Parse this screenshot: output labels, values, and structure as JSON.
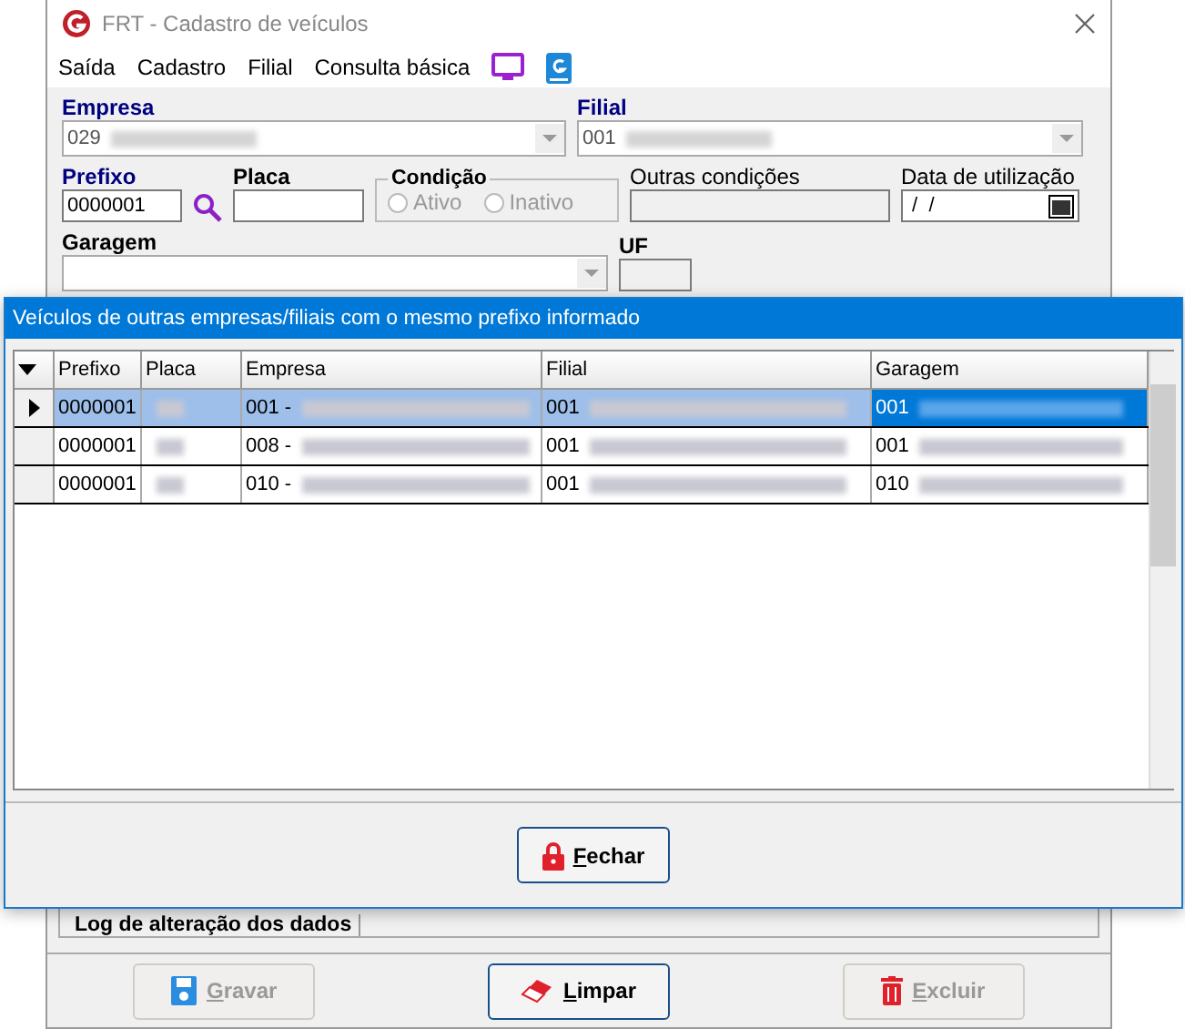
{
  "window": {
    "title": "FRT - Cadastro de veículos"
  },
  "menu": [
    "Saída",
    "Cadastro",
    "Filial",
    "Consulta básica"
  ],
  "form": {
    "empresa": {
      "label": "Empresa",
      "value": "029"
    },
    "filial": {
      "label": "Filial",
      "value": "001"
    },
    "prefixo": {
      "label": "Prefixo",
      "value": "0000001"
    },
    "placa": {
      "label": "Placa"
    },
    "condicao": {
      "label": "Condição",
      "options": [
        {
          "label": "Ativo",
          "selected": false
        },
        {
          "label": "Inativo",
          "selected": false
        }
      ]
    },
    "outras": {
      "label": "Outras condições"
    },
    "data": {
      "label": "Data de utilização",
      "value": " /  /"
    },
    "garagem": {
      "label": "Garagem"
    },
    "uf": {
      "label": "UF"
    }
  },
  "log_tab": "Log de alteração dos dados",
  "buttons": [
    {
      "label": "Gravar",
      "kind": "save",
      "disabled": true
    },
    {
      "label": "Limpar",
      "kind": "eraser",
      "disabled": false
    },
    {
      "label": "Excluir",
      "kind": "trash",
      "disabled": true
    }
  ],
  "dialog": {
    "title": "Veículos de outras empresas/filiais com o mesmo prefixo informado",
    "columns": [
      "Prefixo",
      "Placa",
      "Empresa",
      "Filial",
      "Garagem"
    ],
    "rows": [
      {
        "selected": true,
        "cells": [
          "0000001",
          "",
          "001 -",
          "001",
          "001"
        ]
      },
      {
        "selected": false,
        "cells": [
          "0000001",
          "",
          "008 -",
          "001",
          "001"
        ]
      },
      {
        "selected": false,
        "cells": [
          "0000001",
          "",
          "010 -",
          "001",
          "010"
        ]
      }
    ],
    "close_button": "Fechar"
  }
}
